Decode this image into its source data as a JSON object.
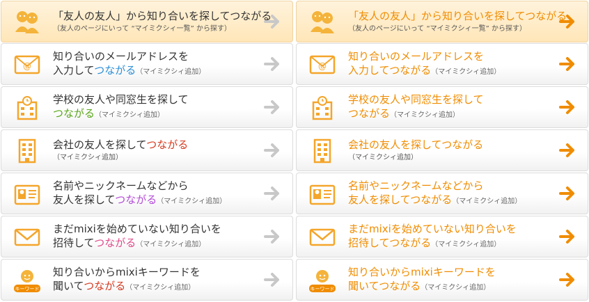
{
  "colors": {
    "orange": "#f08c00",
    "gray_arrow": "#c8c8c8",
    "blue": "#2b8fd6",
    "green": "#5aa61a",
    "red": "#d63a1f",
    "purple": "#b44ad8",
    "pink": "#e04a8a"
  },
  "left": [
    {
      "icon": "friends-icon",
      "line1": "「友人の友人」から知り合いを探してつながる",
      "sub": "（友人のページにいって “マイミクシィ一覧” から探す）"
    },
    {
      "icon": "email-icon",
      "line1": "知り合いのメールアドレスを",
      "line2_pre": "入力して",
      "line2_hl": "つながる",
      "line2_note": "（マイミクシィ追加）"
    },
    {
      "icon": "school-icon",
      "line1": "学校の友人や同窓生を探して",
      "line2_pre": "",
      "line2_hl": "つながる",
      "line2_note": "（マイミクシィ追加）"
    },
    {
      "icon": "company-icon",
      "line1_pre": "会社の友人を探して",
      "line1_hl": "つながる",
      "sub": "（マイミクシィ追加）"
    },
    {
      "icon": "profile-card-icon",
      "line1": "名前やニックネームなどから",
      "line2_pre": "友人を探して",
      "line2_hl": "つながる",
      "line2_note": "（マイミクシィ追加）"
    },
    {
      "icon": "envelope-icon",
      "line1": "まだmixiを始めていない知り合いを",
      "line2_pre": "招待して",
      "line2_hl": "つながる",
      "line2_note": "（マイミクシィ追加）"
    },
    {
      "icon": "keyword-icon",
      "icon_label": "キーワード",
      "line1": "知り合いからmixiキーワードを",
      "line2_pre": "聞いて",
      "line2_hl": "つながる",
      "line2_note": "（マイミクシィ追加）"
    }
  ],
  "right": [
    {
      "icon": "friends-icon",
      "line1": "「友人の友人」から知り合いを探してつながる",
      "sub": "（友人のページにいって “マイミクシィ一覧” から探す）"
    },
    {
      "icon": "email-icon",
      "line1": "知り合いのメールアドレスを",
      "line2_pre": "入力してつながる",
      "line2_note": "（マイミクシィ追加）"
    },
    {
      "icon": "school-icon",
      "line1": "学校の友人や同窓生を探して",
      "line2_pre": "つながる",
      "line2_note": "（マイミクシィ追加）"
    },
    {
      "icon": "company-icon",
      "line1": "会社の友人を探してつながる",
      "sub": "（マイミクシィ追加）"
    },
    {
      "icon": "profile-card-icon",
      "line1": "名前やニックネームなどから",
      "line2_pre": "友人を探してつながる",
      "line2_note": "（マイミクシィ追加）"
    },
    {
      "icon": "envelope-icon",
      "line1": "まだmixiを始めていない知り合いを",
      "line2_pre": "招待してつながる",
      "line2_note": "（マイミクシィ追加）"
    },
    {
      "icon": "keyword-icon",
      "icon_label": "キーワード",
      "line1": "知り合いからmixiキーワードを",
      "line2_pre": "聞いてつながる",
      "line2_note": "（マイミクシィ追加）"
    }
  ]
}
